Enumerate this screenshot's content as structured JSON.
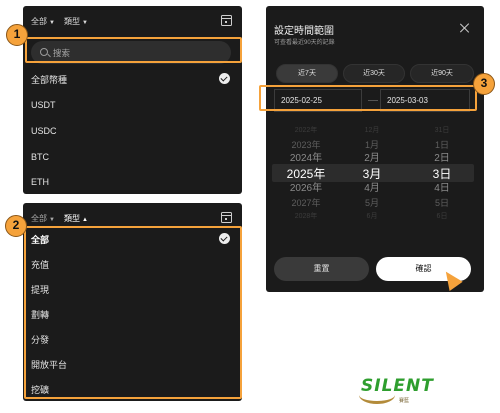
{
  "panel1": {
    "filter_all": "全部",
    "filter_type": "類型",
    "search_placeholder": "搜索",
    "items": [
      "全部幣種",
      "USDT",
      "USDC",
      "BTC",
      "ETH"
    ]
  },
  "panel2": {
    "filter_all": "全部",
    "filter_type": "類型",
    "items": [
      "全部",
      "充值",
      "提現",
      "劃轉",
      "分發",
      "開放平台",
      "挖礦"
    ]
  },
  "dialog": {
    "title": "設定時間範圍",
    "subtitle": "可查看最近90天的記錄",
    "tabs": [
      "近7天",
      "近30天",
      "近90天"
    ],
    "start_date": "2025-02-25",
    "end_date": "2025-03-03",
    "years": [
      "2022年",
      "2023年",
      "2024年",
      "2025年",
      "2026年",
      "2027年",
      "2028年"
    ],
    "months": [
      "12月",
      "1月",
      "2月",
      "3月",
      "4月",
      "5月",
      "6月"
    ],
    "days": [
      "31日",
      "1日",
      "2日",
      "3日",
      "4日",
      "5日",
      "6日"
    ],
    "cancel_label": "重置",
    "confirm_label": "確認"
  },
  "badges": [
    "1",
    "2",
    "3"
  ],
  "logo": {
    "text": "SILENT",
    "sub": "賽藍"
  },
  "colors": {
    "panel": "#1b1b1b",
    "highlight": "#f5a23b",
    "logo_green": "#2e9e2e"
  }
}
